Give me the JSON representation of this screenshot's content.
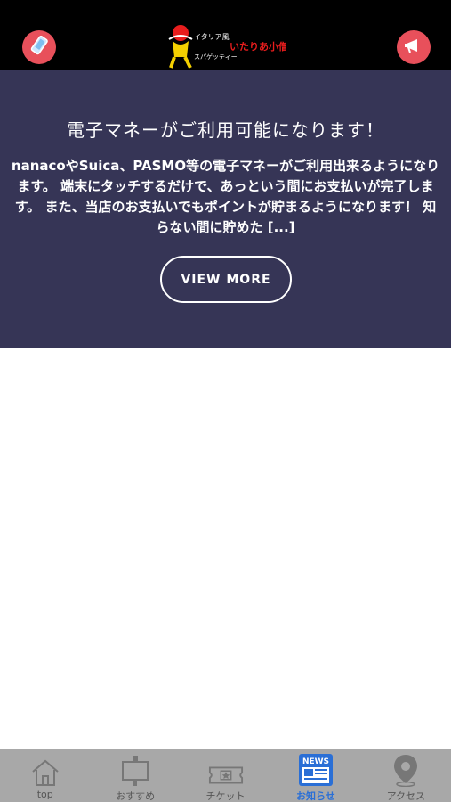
{
  "header": {
    "left_icon": "smartphone-icon",
    "right_icon": "megaphone-icon",
    "logo": {
      "line1": "イタリア風",
      "line2": "スパゲッティー",
      "brand": "いたりあ小僧"
    },
    "accent_color": "#e8505b"
  },
  "news": {
    "title": "電子マネーがご利用可能になります！",
    "body": "nanacoやSuica、PASMO等の電子マネーがご利用出来るようになります。 端末にタッチするだけで、あっという間にお支払いが完了します。 また、当店のお支払いでもポイントが貯まるようになります！ 知らない間に貯めた [...]",
    "button_label": "VIEW MORE",
    "background_color": "#363556"
  },
  "tabbar": {
    "active_color": "#2a6fd6",
    "tabs": [
      {
        "label": "top",
        "icon": "home-icon"
      },
      {
        "label": "おすすめ",
        "icon": "signboard-icon"
      },
      {
        "label": "チケット",
        "icon": "ticket-icon"
      },
      {
        "label": "お知らせ",
        "icon": "news-icon",
        "badge": "NEWS",
        "active": true
      },
      {
        "label": "アクセス",
        "icon": "map-pin-icon"
      }
    ]
  }
}
